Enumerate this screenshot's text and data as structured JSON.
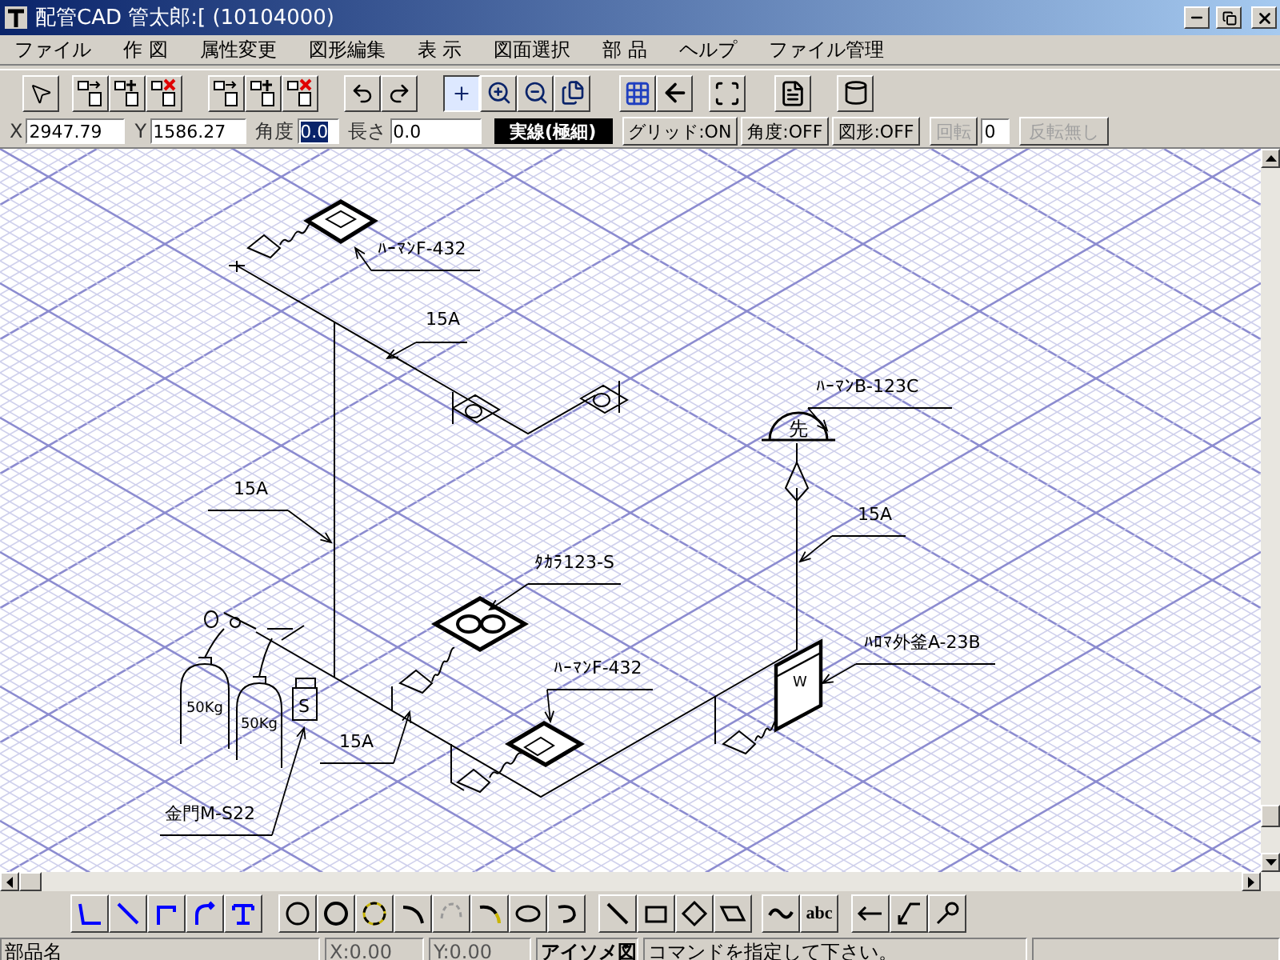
{
  "window": {
    "title": "配管CAD 管太郎:[ (10104000)"
  },
  "menu": [
    "ファイル",
    "作 図",
    "属性変更",
    "図形編集",
    "表 示",
    "図面選択",
    "部 品",
    "ヘルプ",
    "ファイル管理"
  ],
  "toolbar": [
    [
      {
        "kind": "pointer",
        "selected": false
      }
    ],
    [
      {
        "kind": "insert-arrow",
        "selected": false
      },
      {
        "kind": "insert-plus",
        "selected": false
      },
      {
        "kind": "insert-delete",
        "selected": false
      }
    ],
    [
      {
        "kind": "insert-arrow",
        "selected": false
      },
      {
        "kind": "insert-plus",
        "selected": false
      },
      {
        "kind": "insert-delete",
        "selected": false
      }
    ],
    [
      {
        "kind": "undo",
        "selected": false
      },
      {
        "kind": "redo",
        "selected": false
      }
    ],
    [
      {
        "kind": "crosshair",
        "selected": true
      },
      {
        "kind": "zoom-in",
        "selected": false
      },
      {
        "kind": "zoom-out",
        "selected": false
      },
      {
        "kind": "pages",
        "selected": false
      }
    ],
    [
      {
        "kind": "grid",
        "selected": false
      },
      {
        "kind": "back",
        "selected": false
      }
    ],
    [
      {
        "kind": "fit",
        "selected": false
      }
    ],
    [
      {
        "kind": "list",
        "selected": false
      }
    ],
    [
      {
        "kind": "cylinder",
        "selected": false
      }
    ]
  ],
  "coordinate_bar": {
    "fields": [
      {
        "label": "X",
        "value": "2947.79",
        "highlighted": false
      },
      {
        "label": "Y",
        "value": "1586.27",
        "highlighted": false
      },
      {
        "label": "角度",
        "value": "0.0",
        "highlighted": true
      },
      {
        "label": "長さ",
        "value": "0.0",
        "highlighted": false
      }
    ],
    "line_type": "実線(極細)",
    "toggles": [
      "グリッド:ON",
      "角度:OFF",
      "図形:OFF"
    ],
    "rotate": {
      "label": "回転",
      "disabled": true,
      "value": "0"
    },
    "flip": {
      "label": "反転無し",
      "disabled": true
    }
  },
  "drawing": {
    "labels": [
      "ﾊｰﾏﾝF-432",
      "15A",
      "ﾊｰﾏﾝB-123C",
      "15A",
      "15A",
      "ﾀｶﾗ123-S",
      "ﾊﾛﾏ外釜A-23B",
      "ﾊｰﾏﾝF-432",
      "15A",
      "金門M-S22"
    ],
    "symbol_texts": [
      "先",
      "50Kg",
      "50Kg",
      "S",
      "W"
    ]
  },
  "draw_tools": [
    [
      {
        "kind": "corner"
      },
      {
        "kind": "diagonal"
      },
      {
        "kind": "step"
      },
      {
        "kind": "curved-step"
      },
      {
        "kind": "tee"
      }
    ],
    [
      {
        "kind": "circle"
      },
      {
        "kind": "circle-bold"
      },
      {
        "kind": "circle-dashed"
      },
      {
        "kind": "arc"
      },
      {
        "kind": "arc-dashed"
      },
      {
        "kind": "arc-yellow"
      },
      {
        "kind": "ellipse"
      },
      {
        "kind": "hook"
      }
    ],
    [
      {
        "kind": "line"
      },
      {
        "kind": "rectangle"
      },
      {
        "kind": "diamond"
      },
      {
        "kind": "parallelogram"
      }
    ],
    [
      {
        "kind": "wave"
      },
      {
        "kind": "text",
        "label": "abc"
      }
    ],
    [
      {
        "kind": "arrow-left"
      },
      {
        "kind": "leader"
      },
      {
        "kind": "balloon"
      }
    ]
  ],
  "status_bar": [
    "部品名",
    "X:0.00",
    "Y:0.00",
    "アイソメ図",
    "コマンドを指定して下さい。"
  ]
}
